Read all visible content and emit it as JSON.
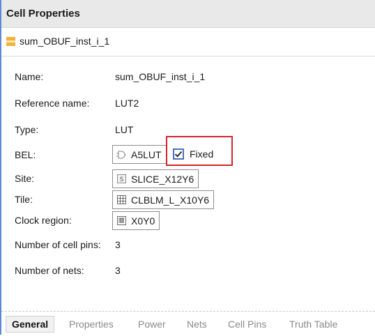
{
  "panel": {
    "title": "Cell Properties",
    "object_name": "sum_OBUF_inst_i_1",
    "object_icon": "cell-icon"
  },
  "properties": {
    "name": {
      "label": "Name:",
      "value": "sum_OBUF_inst_i_1"
    },
    "reference_name": {
      "label": "Reference name:",
      "value": "LUT2"
    },
    "type": {
      "label": "Type:",
      "value": "LUT"
    },
    "bel": {
      "label": "BEL:",
      "value": "A5LUT",
      "icon": "lut-icon"
    },
    "fixed": {
      "label": "Fixed",
      "checked": true
    },
    "site": {
      "label": "Site:",
      "value": "SLICE_X12Y6",
      "icon": "slice-icon"
    },
    "tile": {
      "label": "Tile:",
      "value": "CLBLM_L_X10Y6",
      "icon": "tile-grid-icon"
    },
    "clock_region": {
      "label": "Clock region:",
      "value": "X0Y0",
      "icon": "clock-region-icon"
    },
    "num_cell_pins": {
      "label": "Number of cell pins:",
      "value": "3"
    },
    "num_nets": {
      "label": "Number of nets:",
      "value": "3"
    }
  },
  "tabs": [
    {
      "label": "General",
      "active": true
    },
    {
      "label": "Properties",
      "active": false
    },
    {
      "label": "Power",
      "active": false
    },
    {
      "label": "Nets",
      "active": false
    },
    {
      "label": "Cell Pins",
      "active": false
    },
    {
      "label": "Truth Table",
      "active": false
    }
  ],
  "colors": {
    "highlight": "#d0252d",
    "checkbox_border": "#4a6fb8",
    "panel_accent": "#5a8ad6",
    "cell_icon": "#f0b43c"
  }
}
